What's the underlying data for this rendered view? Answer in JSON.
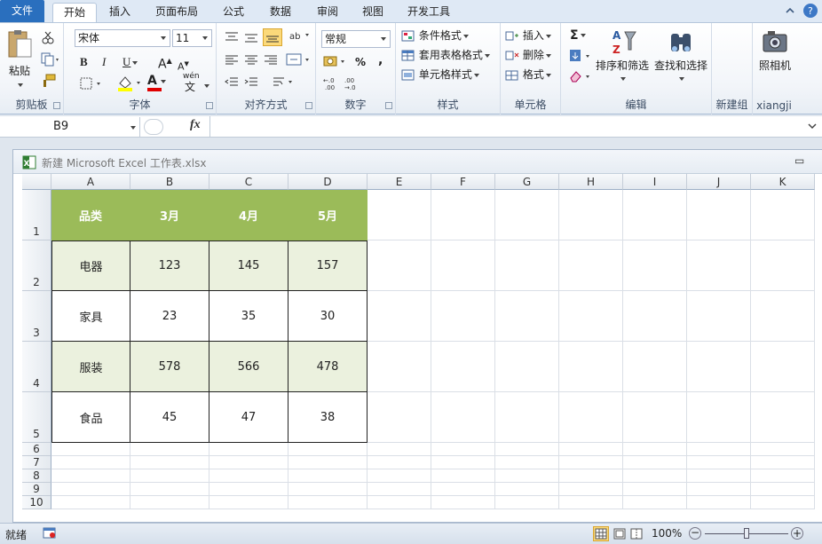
{
  "tabs": [
    "文件",
    "开始",
    "插入",
    "页面布局",
    "公式",
    "数据",
    "审阅",
    "视图",
    "开发工具"
  ],
  "ribbon": {
    "clipboard": {
      "label": "剪贴板",
      "paste": "粘贴"
    },
    "font": {
      "label": "字体",
      "name": "宋体",
      "size": "11",
      "bold": "B",
      "italic": "I",
      "underline": "U",
      "grow": "A",
      "shrink": "A",
      "fill_letter": "A",
      "wen": "wén"
    },
    "align": {
      "label": "对齐方式"
    },
    "number": {
      "label": "数字",
      "format": "常规",
      "percent": "%",
      "comma": ","
    },
    "styles": {
      "label": "样式",
      "cond": "条件格式",
      "table": "套用表格格式",
      "cell": "单元格样式"
    },
    "cells": {
      "label": "单元格",
      "insert": "插入",
      "delete": "删除",
      "format": "格式"
    },
    "editing": {
      "label": "编辑",
      "sum": "Σ",
      "sort": "排序和筛选",
      "find": "查找和选择"
    },
    "newgroup": {
      "label": "新建组"
    },
    "xiangji": {
      "label": "xiangji",
      "camera": "照相机"
    }
  },
  "formula": {
    "namebox": "B9",
    "fx": "fx",
    "value": ""
  },
  "workbook": {
    "title": "新建 Microsoft Excel 工作表.xlsx",
    "minimize": "▭"
  },
  "columns": [
    "A",
    "B",
    "C",
    "D",
    "E",
    "F",
    "G",
    "H",
    "I",
    "J",
    "K"
  ],
  "rows": [
    "1",
    "2",
    "3",
    "4",
    "5",
    "6",
    "7",
    "8",
    "9",
    "10"
  ],
  "table": {
    "header": [
      "品类",
      "3月",
      "4月",
      "5月"
    ],
    "body": [
      [
        "电器",
        "123",
        "145",
        "157"
      ],
      [
        "家具",
        "23",
        "35",
        "30"
      ],
      [
        "服装",
        "578",
        "566",
        "478"
      ],
      [
        "食品",
        "45",
        "47",
        "38"
      ]
    ]
  },
  "colors": {
    "header_fill": "#9bbb59",
    "band_fill": "#ebf1de",
    "header_text": "#ffffff"
  },
  "status": {
    "ready": "就绪",
    "zoom": "100%",
    "minus": "−",
    "plus": "+"
  }
}
